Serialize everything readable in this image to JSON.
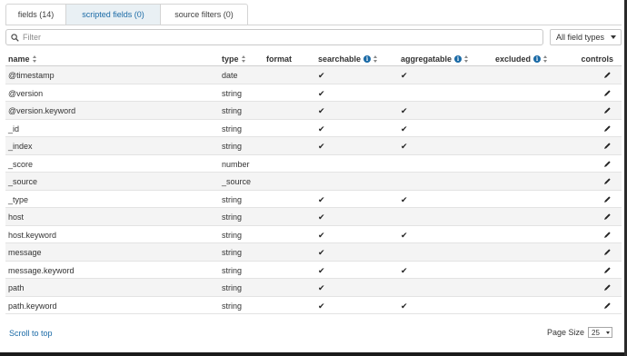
{
  "tabs": [
    {
      "label": "fields (14)",
      "active": true
    },
    {
      "label": "scripted fields (0)",
      "active": false
    },
    {
      "label": "source filters (0)",
      "active": false
    }
  ],
  "filter": {
    "placeholder": "Filter",
    "value": ""
  },
  "field_type_select": {
    "selected": "All field types"
  },
  "columns": {
    "name": "name",
    "type": "type",
    "format": "format",
    "searchable": "searchable",
    "aggregatable": "aggregatable",
    "excluded": "excluded",
    "controls": "controls"
  },
  "rows": [
    {
      "name": "@timestamp",
      "type": "date",
      "searchable": true,
      "aggregatable": true
    },
    {
      "name": "@version",
      "type": "string",
      "searchable": true,
      "aggregatable": false
    },
    {
      "name": "@version.keyword",
      "type": "string",
      "searchable": true,
      "aggregatable": true
    },
    {
      "name": "_id",
      "type": "string",
      "searchable": true,
      "aggregatable": true
    },
    {
      "name": "_index",
      "type": "string",
      "searchable": true,
      "aggregatable": true
    },
    {
      "name": "_score",
      "type": "number",
      "searchable": false,
      "aggregatable": false
    },
    {
      "name": "_source",
      "type": "_source",
      "searchable": false,
      "aggregatable": false
    },
    {
      "name": "_type",
      "type": "string",
      "searchable": true,
      "aggregatable": true
    },
    {
      "name": "host",
      "type": "string",
      "searchable": true,
      "aggregatable": false
    },
    {
      "name": "host.keyword",
      "type": "string",
      "searchable": true,
      "aggregatable": true
    },
    {
      "name": "message",
      "type": "string",
      "searchable": true,
      "aggregatable": false
    },
    {
      "name": "message.keyword",
      "type": "string",
      "searchable": true,
      "aggregatable": true
    },
    {
      "name": "path",
      "type": "string",
      "searchable": true,
      "aggregatable": false
    },
    {
      "name": "path.keyword",
      "type": "string",
      "searchable": true,
      "aggregatable": true
    }
  ],
  "footer": {
    "scroll_to_top": "Scroll to top",
    "page_size_label": "Page Size",
    "page_size_value": "25"
  },
  "icons": {
    "search": "search-icon",
    "sort": "sort-icon",
    "info": "info-icon",
    "check": "checkmark-icon",
    "edit": "pencil-icon"
  },
  "colors": {
    "accent": "#1a6aa6",
    "active_tab_bg": "#e9f0f4",
    "stripe": "#f4f4f4"
  }
}
